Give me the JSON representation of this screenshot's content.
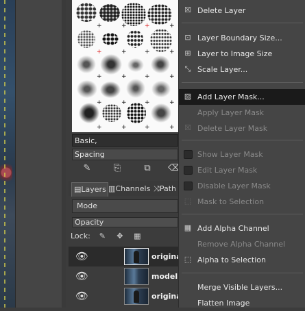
{
  "brushes": {
    "selected_name": "Basic,",
    "spacing_label": "Spacing"
  },
  "dock": {
    "tabs": [
      {
        "label": "Layers"
      },
      {
        "label": "Channels"
      },
      {
        "label": "Path"
      }
    ],
    "mode_label": "Mode",
    "opacity_label": "Opacity",
    "lock_label": "Lock:"
  },
  "layers": [
    {
      "name": "origina",
      "selected": true
    },
    {
      "name": "model",
      "selected": false
    },
    {
      "name": "origina",
      "selected": false
    }
  ],
  "menu": {
    "items": [
      {
        "label": "Delete Layer",
        "icon": "delete-icon",
        "enabled": true
      },
      {
        "label": "Layer Boundary Size...",
        "icon": "resize-icon",
        "enabled": true
      },
      {
        "label": "Layer to Image Size",
        "icon": "fit-icon",
        "enabled": true
      },
      {
        "label": "Scale Layer...",
        "icon": "scale-icon",
        "enabled": true
      },
      {
        "label": "Add Layer Mask...",
        "icon": "mask-icon",
        "enabled": true,
        "highlighted": true
      },
      {
        "label": "Apply Layer Mask",
        "icon": "",
        "enabled": false
      },
      {
        "label": "Delete Layer Mask",
        "icon": "delete-icon",
        "enabled": false
      },
      {
        "label": "Show Layer Mask",
        "icon": "checkbox",
        "enabled": false
      },
      {
        "label": "Edit Layer Mask",
        "icon": "checkbox",
        "enabled": false
      },
      {
        "label": "Disable Layer Mask",
        "icon": "checkbox",
        "enabled": false
      },
      {
        "label": "Mask to Selection",
        "icon": "selection-icon",
        "enabled": false
      },
      {
        "label": "Add Alpha Channel",
        "icon": "alpha-icon",
        "enabled": true
      },
      {
        "label": "Remove Alpha Channel",
        "icon": "",
        "enabled": false
      },
      {
        "label": "Alpha to Selection",
        "icon": "selection-icon",
        "enabled": true
      },
      {
        "label": "Merge Visible Layers...",
        "icon": "",
        "enabled": true
      },
      {
        "label": "Flatten Image",
        "icon": "",
        "enabled": true
      }
    ]
  }
}
